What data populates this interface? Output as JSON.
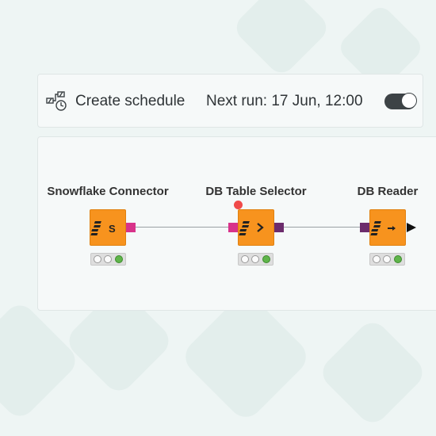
{
  "schedule": {
    "label": "Create schedule",
    "next_run": "Next run: 17 Jun, 12:00",
    "toggle_on": true
  },
  "workflow": {
    "nodes": [
      {
        "title": "Snowflake Connector",
        "icon": "snowflake-connector-icon",
        "status": "executed"
      },
      {
        "title": "DB Table Selector",
        "icon": "db-table-selector-icon",
        "status": "executed",
        "has_warning": true
      },
      {
        "title": "DB Reader",
        "icon": "db-reader-icon",
        "status": "executed"
      }
    ]
  },
  "colors": {
    "node": "#f7931e",
    "db_port": "#d8338a",
    "db_data_port": "#6c2c6c",
    "status_green": "#5fb54a",
    "warning": "#f04a4a",
    "background": "#eef5f4"
  }
}
